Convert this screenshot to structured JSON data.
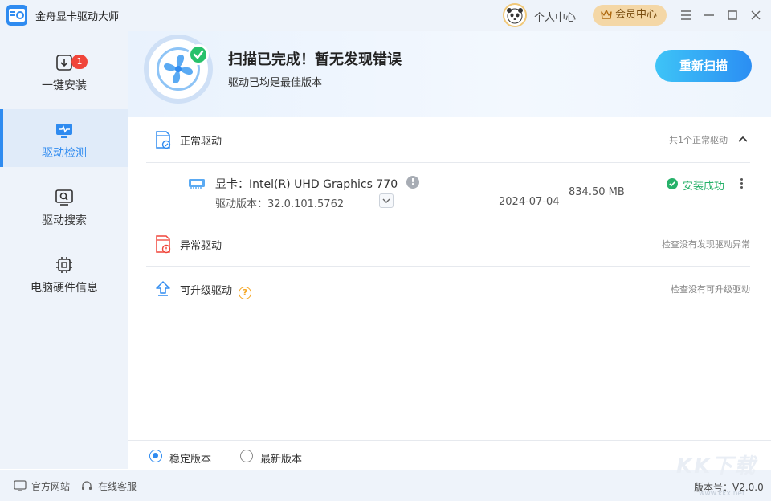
{
  "app": {
    "title": "金舟显卡驱动大师"
  },
  "titlebar": {
    "personal_label": "个人中心",
    "vip_label": "会员中心",
    "icons": [
      "menu-icon",
      "minimize-icon",
      "maximize-icon",
      "close-icon"
    ]
  },
  "sidebar": {
    "items": [
      {
        "label": "一键安装",
        "icon": "download-icon",
        "badge": "1"
      },
      {
        "label": "驱动检测",
        "icon": "pulse-monitor-icon",
        "active": true
      },
      {
        "label": "驱动搜索",
        "icon": "search-monitor-icon"
      },
      {
        "label": "电脑硬件信息",
        "icon": "chip-icon"
      }
    ]
  },
  "banner": {
    "title": "扫描已完成！暂无发现错误",
    "subtitle": "驱动已均是最佳版本",
    "rescan_label": "重新扫描"
  },
  "sections": {
    "normal": {
      "title": "正常驱动",
      "note": "共1个正常驱动"
    },
    "abnormal": {
      "title": "异常驱动",
      "note": "检查没有发现驱动异常"
    },
    "upgradable": {
      "title": "可升级驱动",
      "note": "检查没有可升级驱动"
    }
  },
  "driver": {
    "name": "显卡：Intel(R) UHD Graphics 770",
    "version": "驱动版本：32.0.101.5762",
    "date": "2024-07-04",
    "size": "834.50 MB",
    "status": "安装成功"
  },
  "version_options": [
    {
      "label": "稳定版本",
      "selected": true
    },
    {
      "label": "最新版本",
      "selected": false
    }
  ],
  "footer": {
    "website": "官方网站",
    "support": "在线客服",
    "version": "版本号：V2.0.0",
    "watermark": "KK下载",
    "watermark_url": "www.kkx.net"
  },
  "colors": {
    "accent": "#2f8bf0",
    "success": "#27b16a",
    "badge": "#f0453a",
    "vip": "#f4d7a6"
  }
}
